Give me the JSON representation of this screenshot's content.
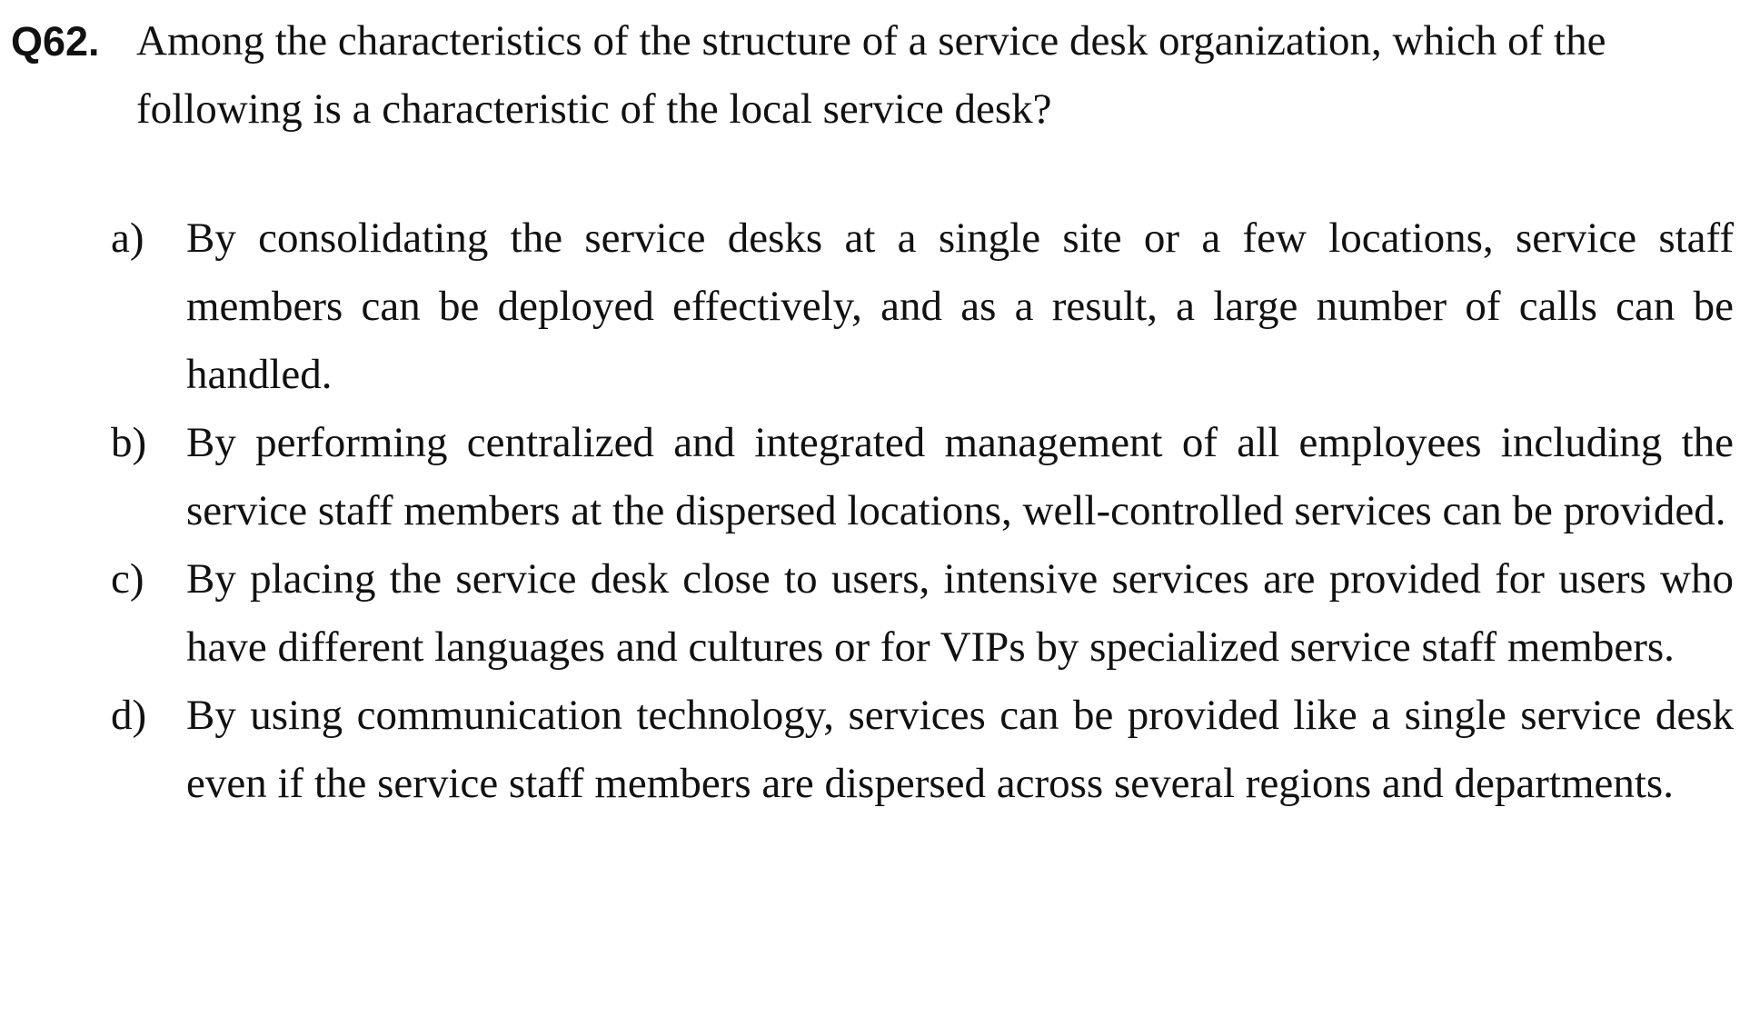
{
  "question": {
    "number": "Q62.",
    "stem": "Among the characteristics of the structure of a service desk organization, which of the following is a characteristic of the local service desk?"
  },
  "options": [
    {
      "letter": "a)",
      "text": "By consolidating the service desks at a single site or a few locations, service staff members can be deployed effectively, and as a result, a large number of calls can be handled."
    },
    {
      "letter": "b)",
      "text": "By performing centralized and integrated management of all employees including the service staff members at the dispersed locations, well-controlled services can be provided."
    },
    {
      "letter": "c)",
      "text": "By placing the service desk close to users, intensive services are provided for users who have different languages and cultures or for VIPs by specialized service staff members."
    },
    {
      "letter": "d)",
      "text": "By using communication technology, services can be provided like a single service desk even if the service staff members are dispersed across several regions and departments."
    }
  ]
}
